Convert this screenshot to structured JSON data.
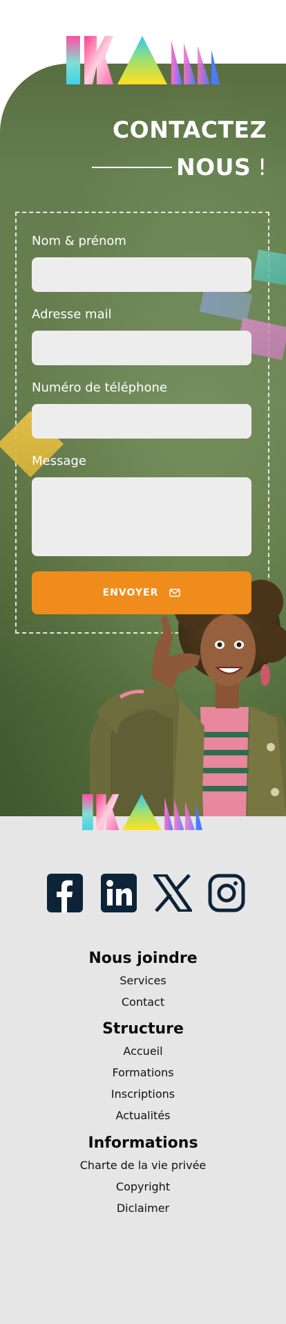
{
  "brand": {
    "logo_text": "IKAM"
  },
  "contact": {
    "title_line1": "CONTACTEZ",
    "title_line2": "NOUS",
    "title_mark": "!",
    "fields": [
      {
        "label": "Nom & prénom",
        "value": ""
      },
      {
        "label": "Adresse mail",
        "value": ""
      },
      {
        "label": "Numéro de téléphone",
        "value": ""
      },
      {
        "label": "Message",
        "value": ""
      }
    ],
    "send_label": "ENVOYER",
    "send_icon": "mail-icon"
  },
  "colors": {
    "panel_green": "#7b9760",
    "accent_orange": "#f08c1c",
    "field_bg": "#ededed",
    "footer_bg": "#e6e6e7",
    "icon_navy": "#0d2438"
  },
  "footer": {
    "socials": [
      {
        "name": "facebook-icon"
      },
      {
        "name": "linkedin-icon"
      },
      {
        "name": "x-icon"
      },
      {
        "name": "instagram-icon"
      }
    ],
    "sections": [
      {
        "heading": "Nous joindre",
        "links": [
          "Services",
          "Contact"
        ]
      },
      {
        "heading": "Structure",
        "links": [
          "Accueil",
          "Formations",
          "Inscriptions",
          "Actualités"
        ]
      },
      {
        "heading": "Informations",
        "links": [
          "Charte de la vie privée",
          "Copyright",
          "Diclaimer"
        ]
      }
    ]
  }
}
